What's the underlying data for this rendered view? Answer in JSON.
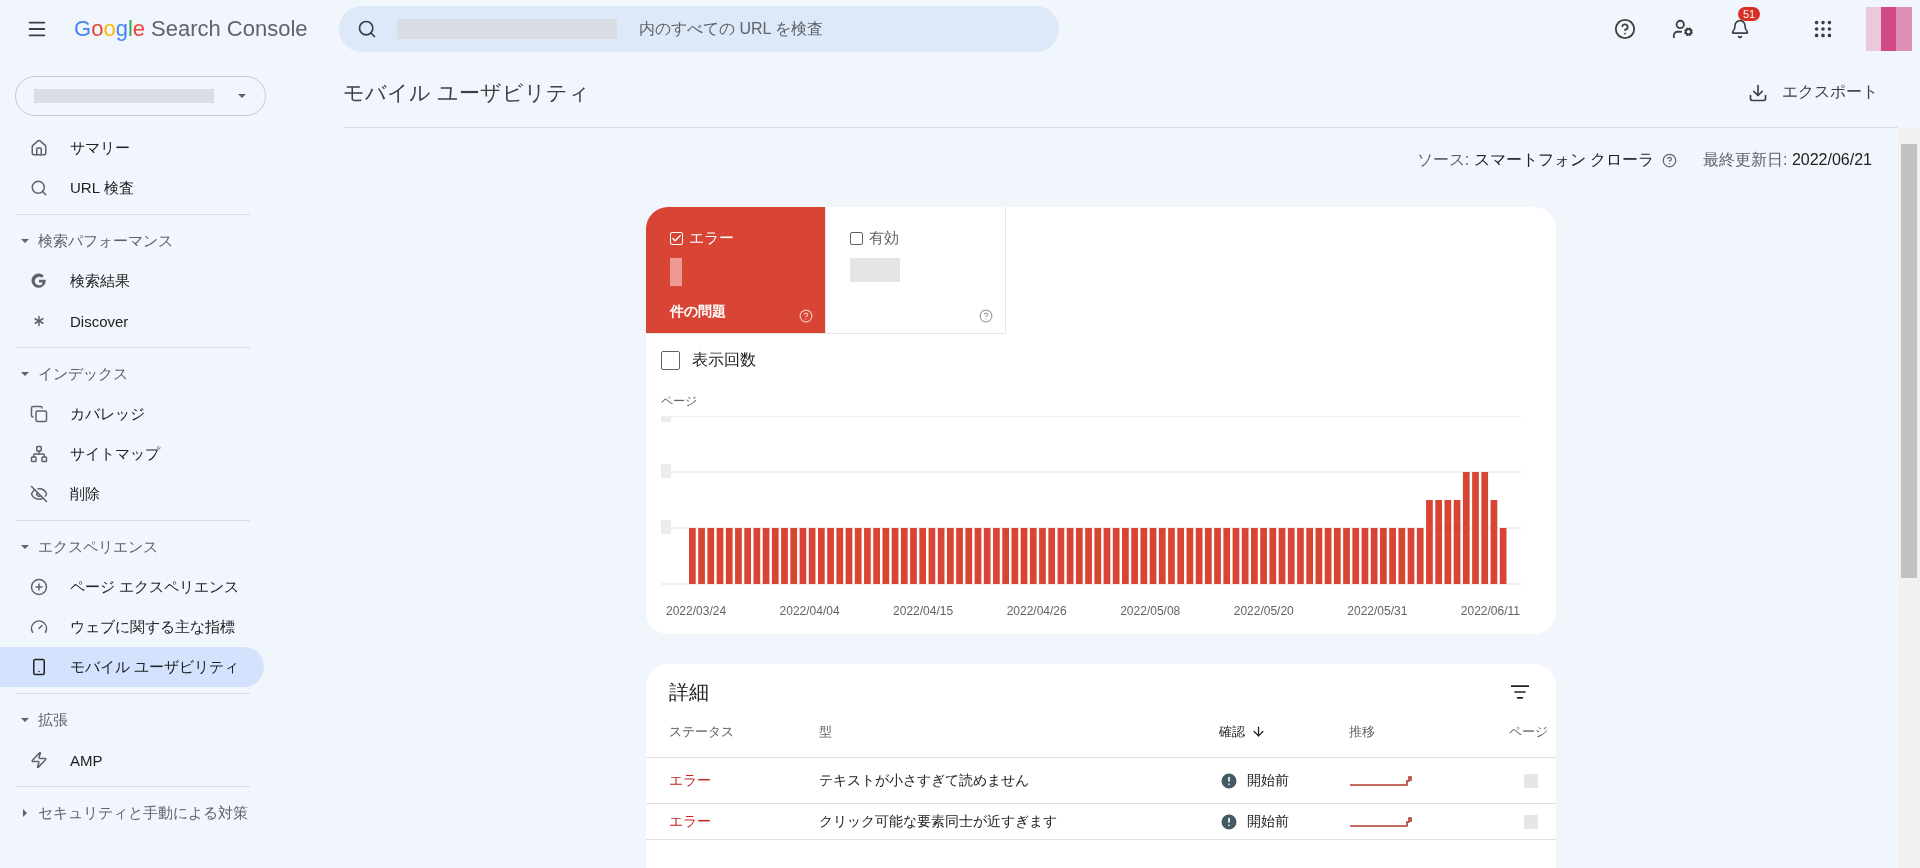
{
  "header": {
    "logo": "Google",
    "product": "Search Console",
    "search": {
      "placeholder": "内のすべての URL を検査"
    },
    "notifications": "51"
  },
  "sidebar": {
    "top_items": [
      {
        "label": "サマリー",
        "selected": false
      },
      {
        "label": "URL 検査",
        "selected": false
      }
    ],
    "sections": [
      {
        "label": "検索パフォーマンス",
        "expanded": true,
        "items": [
          {
            "label": "検索結果",
            "selected": false
          },
          {
            "label": "Discover",
            "selected": false
          }
        ]
      },
      {
        "label": "インデックス",
        "expanded": true,
        "items": [
          {
            "label": "カバレッジ",
            "selected": false
          },
          {
            "label": "サイトマップ",
            "selected": false
          },
          {
            "label": "削除",
            "selected": false
          }
        ]
      },
      {
        "label": "エクスペリエンス",
        "expanded": true,
        "items": [
          {
            "label": "ページ エクスペリエンス",
            "selected": false
          },
          {
            "label": "ウェブに関する主な指標",
            "selected": false
          },
          {
            "label": "モバイル ユーザビリティ",
            "selected": true
          }
        ]
      },
      {
        "label": "拡張",
        "expanded": true,
        "items": [
          {
            "label": "AMP",
            "selected": false
          }
        ]
      },
      {
        "label": "セキュリティと手動による対策",
        "expanded": false
      }
    ]
  },
  "page": {
    "title": "モバイル ユーザビリティ",
    "export": "エクスポート",
    "source_label": "ソース:",
    "source_value": "スマートフォン クローラ",
    "updated_label": "最終更新日:",
    "updated_value": "2022/06/21"
  },
  "tiles": [
    {
      "label": "エラー",
      "checked": true,
      "caption": "件の問題"
    },
    {
      "label": "有効",
      "checked": false
    }
  ],
  "impressions": {
    "label": "表示回数",
    "checked": false
  },
  "chart": {
    "y_label": "ページ",
    "x_labels": [
      "2022/03/24",
      "2022/04/04",
      "2022/04/15",
      "2022/04/26",
      "2022/05/08",
      "2022/05/20",
      "2022/05/31",
      "2022/06/11"
    ]
  },
  "details": {
    "title": "詳細",
    "columns": [
      {
        "label": "ステータス",
        "sorted": false
      },
      {
        "label": "型",
        "sorted": false
      },
      {
        "label": "確認",
        "sorted": true
      },
      {
        "label": "推移",
        "sorted": false
      },
      {
        "label": "ページ",
        "sorted": false
      }
    ],
    "rows": [
      {
        "status": "エラー",
        "type": "テキストが小さすぎて読めません",
        "validation": "開始前"
      },
      {
        "status": "エラー",
        "type": "クリック可能な要素同士が近すぎます",
        "validation": "開始前"
      }
    ]
  }
}
